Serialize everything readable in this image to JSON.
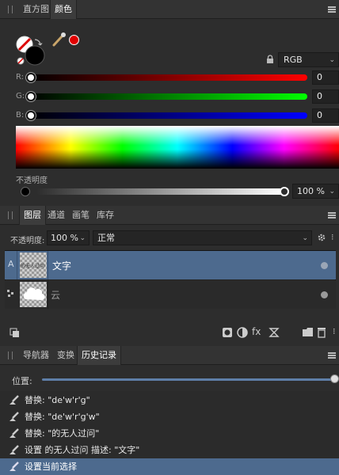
{
  "top_tabs": {
    "histogram": "直方图",
    "color": "颜色"
  },
  "color_panel": {
    "model": "RGB",
    "channels": [
      {
        "label": "R:",
        "value": "0"
      },
      {
        "label": "G:",
        "value": "0"
      },
      {
        "label": "B:",
        "value": "0"
      }
    ],
    "opacity_label": "不透明度",
    "opacity_value": "100 %",
    "picker_color": "#e00000"
  },
  "layers_tabs": {
    "layers": "图层",
    "channels": "通道",
    "brushes": "画笔",
    "library": "库存"
  },
  "layers_panel": {
    "opacity_label": "不透明度:",
    "opacity_value": "100 %",
    "blend_mode": "正常",
    "layers": [
      {
        "name": "文字",
        "type_badge": "A",
        "thumb_text": "的无人过问",
        "selected": true
      },
      {
        "name": "云",
        "selected": false
      }
    ]
  },
  "history_tabs": {
    "navigator": "导航器",
    "transform": "变换",
    "history": "历史记录"
  },
  "history_panel": {
    "position_label": "位置:",
    "position": 1.0,
    "entries": [
      "替换: \"de'w'r'g\"",
      "替换: \"de'w'r'g'w\"",
      "替换: \"的无人过问\"",
      "设置 的无人过问 描述: \"文字\"",
      "设置当前选择"
    ]
  }
}
